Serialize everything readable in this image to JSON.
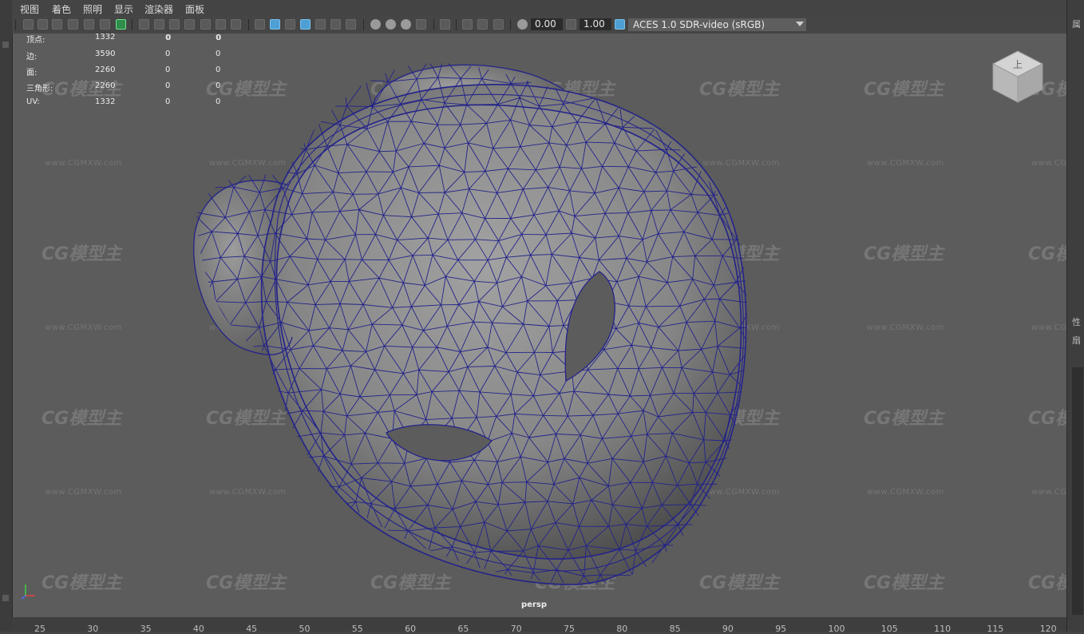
{
  "menu": [
    "视图",
    "着色",
    "照明",
    "显示",
    "渲染器",
    "面板"
  ],
  "toolbar": {
    "exposure_value": "0.00",
    "gamma_value": "1.00",
    "colorspace": "ACES 1.0 SDR-video (sRGB)"
  },
  "hud": {
    "rows": [
      {
        "label": "顶点:",
        "value": "1332",
        "a": "0",
        "b": "0"
      },
      {
        "label": "边:",
        "value": "3590",
        "a": "0",
        "b": "0"
      },
      {
        "label": "面:",
        "value": "2260",
        "a": "0",
        "b": "0"
      },
      {
        "label": "三角形:",
        "value": "2260",
        "a": "0",
        "b": "0"
      },
      {
        "label": "UV:",
        "value": "1332",
        "a": "0",
        "b": "0"
      }
    ],
    "top_row": {
      "a": "0",
      "b": "0"
    }
  },
  "viewport": {
    "camera": "persp"
  },
  "view_cube": {
    "face": "上"
  },
  "watermark": {
    "logo": "CG模型主",
    "url": "www.CGMXW.com"
  },
  "timeline": {
    "ticks": [
      "25",
      "30",
      "35",
      "40",
      "45",
      "50",
      "55",
      "60",
      "65",
      "70",
      "75",
      "80",
      "85",
      "90",
      "95",
      "100",
      "105",
      "110",
      "115",
      "120"
    ]
  },
  "right_panel": {
    "labels": [
      "属",
      "性",
      "扇"
    ]
  },
  "colors": {
    "wire": "#23238a",
    "viewport_bg": "#5c5c5c",
    "accent": "#4d9fd4"
  }
}
